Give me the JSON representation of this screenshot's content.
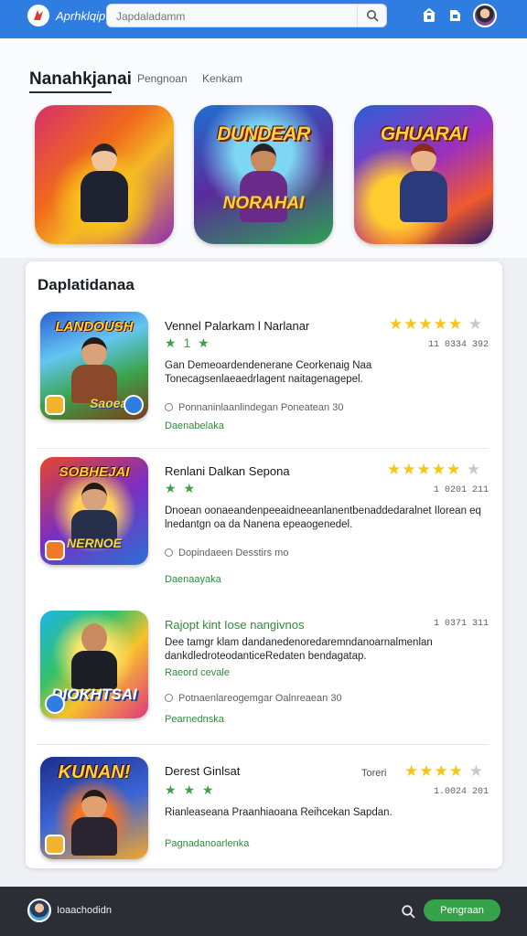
{
  "header": {
    "app_name": "Aprhklqip",
    "search_placeholder": "Japdaladamm",
    "search_value": "Japdaladamm",
    "accent": "#2f7de1"
  },
  "featured": {
    "title": "Nanahkjanai",
    "tabs": [
      "Pengnoan",
      "Kenkam"
    ],
    "cards": [
      {
        "logo_top": "",
        "logo_bottom": ""
      },
      {
        "logo_top": "DUNDEAR",
        "logo_bottom": "NORAHAI"
      },
      {
        "logo_top": "GHUARAI",
        "logo_bottom": ""
      }
    ]
  },
  "list": {
    "title": "Daplatidanaa",
    "games": [
      {
        "title": "Vennel Palarkam l Narlanar",
        "mini_stars": "★ 1 ★",
        "stars": 4,
        "rating_num": "11 0334 392",
        "desc": "Gan Demeoardendenerane Ceorkenaig Naa Tonecagsenlaeaedrlagent naitagenagepel.",
        "meta": "Ponnaninlaanlindegan Poneatean 30",
        "link": "Daenabelaka",
        "price": "",
        "thumb_logo": "LANDOUSH",
        "thumb_logo_b": "Saoean",
        "title_color": "dark",
        "icon": "game-icon"
      },
      {
        "title": "Renlani Dalkan Sepona",
        "mini_stars": "★ ★",
        "stars": 4,
        "rating_num": "1 0201 211",
        "desc": "Dnoean oonaeandenpeeaidneeanlanentbenaddedaralnet Ilorean eq lnedantgn oa da Nanena epeaogenedel.",
        "meta": "Dopindaeen Desstirs mo",
        "link": "Daenaayaka",
        "price": "",
        "thumb_logo": "SOBHEJAI",
        "thumb_logo_b": "NERNOE",
        "title_color": "dark",
        "icon": "game-icon"
      },
      {
        "title": "Rajopt kint Iose nangivnos",
        "mini_stars": "",
        "stars": 0,
        "rating_num": "1 0371 311",
        "desc": "Dee tamgr klam dandanedenoredaremndanoarnalmenlan dankdledroteodanticeRedaten bendagatap.",
        "meta": "Potnaenlareogemgar Oalnreaean 30",
        "link": "Pearnednska",
        "link_top": "Raeord cevale",
        "price": "",
        "thumb_logo": "",
        "thumb_logo_b": "DIOKHTSAI",
        "title_color": "green",
        "icon": "game-icon"
      },
      {
        "title": "Derest Ginlsat",
        "mini_stars": "★ ★ ★",
        "stars": 4,
        "rating_num": "1.0024 201",
        "desc": "Rianleaseana Praanhiaoana Reihcekan Sapdan.",
        "meta": "",
        "link": "Pagnadanoarlenka",
        "price": "Toreri",
        "thumb_logo": "KUNAN!",
        "thumb_logo_b": "",
        "title_color": "dark",
        "icon": "game-icon"
      }
    ]
  },
  "bottom": {
    "username": "Ioaachodidn",
    "button_label": "Pengraan"
  }
}
